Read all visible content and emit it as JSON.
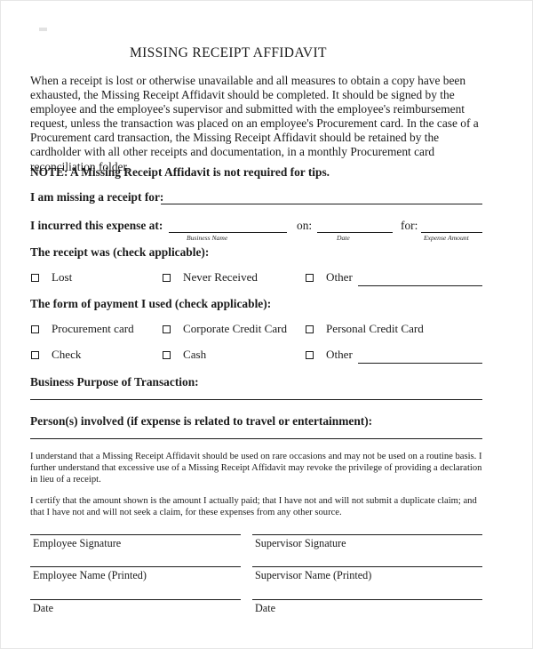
{
  "document": {
    "title": "MISSING RECEIPT AFFIDAVIT",
    "intro_paragraph": "When a receipt is lost or otherwise unavailable and all measures to obtain a copy have been exhausted, the Missing Receipt Affidavit should be completed.  It should be signed by the employee and the employee's supervisor and submitted with the employee's reimbursement request, unless the transaction was placed on an employee's Procurement card.  In the case of a Procurement card transaction, the Missing Receipt Affidavit should be retained by the cardholder with all other receipts and documentation, in a monthly Procurement card reconciliation folder.",
    "note": "NOTE:  A Missing Receipt Affidavit is not required for tips."
  },
  "fields": {
    "missing_receipt_for": {
      "label": "I am missing a receipt for:",
      "value": ""
    },
    "incurred_at": {
      "label": "I incurred this expense at:",
      "value": "",
      "sublabel": "Business Name"
    },
    "on_date": {
      "label": "on:",
      "value": "",
      "sublabel": "Date"
    },
    "for_amount": {
      "label": "for:",
      "value": "",
      "sublabel": "Expense Amount"
    },
    "business_purpose": {
      "label": "Business Purpose of Transaction:",
      "value": ""
    },
    "persons_involved": {
      "label": "Person(s) involved (if expense is related to travel or entertainment):",
      "value": ""
    }
  },
  "receipt_status": {
    "heading": "The receipt was (check applicable):",
    "options": [
      {
        "label": "Lost",
        "checked": false,
        "has_line": false
      },
      {
        "label": "Never Received",
        "checked": false,
        "has_line": false
      },
      {
        "label": "Other",
        "checked": false,
        "has_line": true,
        "value": ""
      }
    ]
  },
  "payment_form": {
    "heading": "The form of payment I used (check applicable):",
    "options": [
      {
        "label": "Procurement card",
        "checked": false,
        "has_line": false
      },
      {
        "label": "Corporate Credit Card",
        "checked": false,
        "has_line": false
      },
      {
        "label": "Personal Credit Card",
        "checked": false,
        "has_line": false
      },
      {
        "label": "Check",
        "checked": false,
        "has_line": false
      },
      {
        "label": "Cash",
        "checked": false,
        "has_line": false
      },
      {
        "label": "Other",
        "checked": false,
        "has_line": true,
        "value": ""
      }
    ]
  },
  "disclaimers": [
    "I understand that a Missing Receipt Affidavit should be used on rare occasions and may not be used on a routine basis.  I further understand that excessive use of a Missing Receipt Affidavit may revoke the privilege of providing a declaration in lieu of a receipt.",
    "I certify that the amount shown is the amount I actually paid; that I have not and will not submit a duplicate claim; and that I have not and will not seek a claim, for these expenses from any other source."
  ],
  "signature_block": {
    "left_column": [
      {
        "label": "Employee Signature",
        "value": ""
      },
      {
        "label": "Employee Name (Printed)",
        "value": ""
      },
      {
        "label": "Date",
        "value": ""
      }
    ],
    "right_column": [
      {
        "label": "Supervisor Signature",
        "value": ""
      },
      {
        "label": "Supervisor Name (Printed)",
        "value": ""
      },
      {
        "label": "Date",
        "value": ""
      }
    ]
  },
  "colors": {
    "ink": "#1b1b1b",
    "page": "#ffffff",
    "page_border": "#e6e6e6"
  }
}
